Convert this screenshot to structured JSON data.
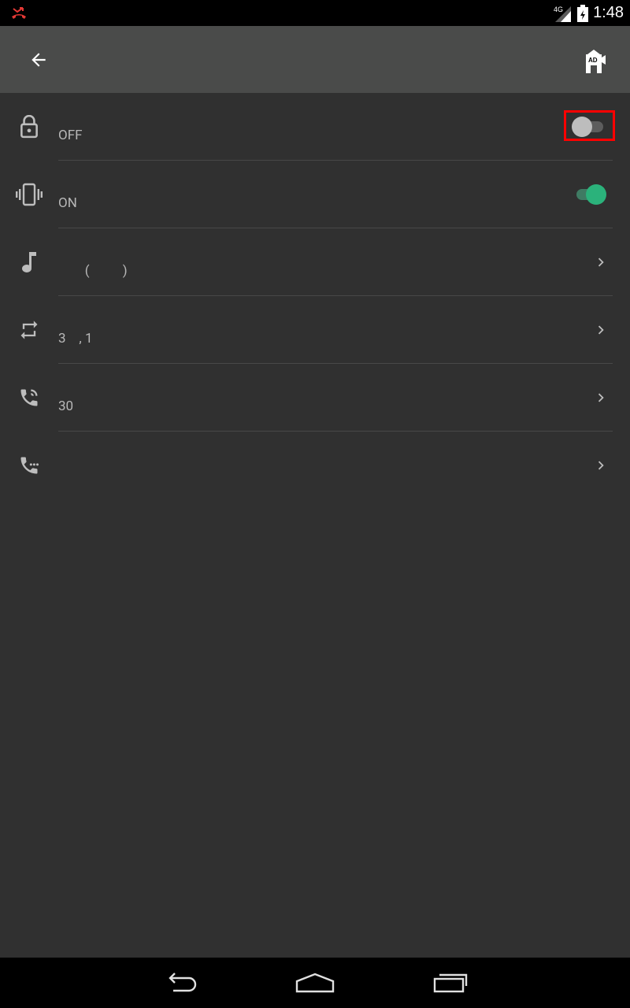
{
  "status_bar": {
    "time": "1:48",
    "network_label": "4G",
    "icons": [
      "missed-call-icon",
      "signal-icon",
      "battery-icon"
    ]
  },
  "app_bar": {
    "back_icon": "back-arrow-icon",
    "action_icon": "ad-block-icon",
    "action_label": "AD"
  },
  "settings": [
    {
      "icon": "lock-icon",
      "subtext": "OFF",
      "control": "toggle",
      "toggle_on": false,
      "highlighted": true
    },
    {
      "icon": "vibrate-icon",
      "subtext": "ON",
      "control": "toggle",
      "toggle_on": true
    },
    {
      "icon": "music-note-icon",
      "subtext": "        (          )",
      "control": "chevron"
    },
    {
      "icon": "repeat-icon",
      "subtext": "3    , 1",
      "control": "chevron"
    },
    {
      "icon": "phone-in-call-icon",
      "subtext": "30",
      "control": "chevron"
    },
    {
      "icon": "phone-dialpad-icon",
      "subtext": "",
      "control": "chevron"
    }
  ],
  "nav_bar": {
    "icons": [
      "back-nav-icon",
      "home-nav-icon",
      "recents-nav-icon"
    ]
  },
  "colors": {
    "background": "#303030",
    "app_bar": "#4a4b4a",
    "accent": "#2bb27b",
    "highlight": "#ff0000"
  }
}
